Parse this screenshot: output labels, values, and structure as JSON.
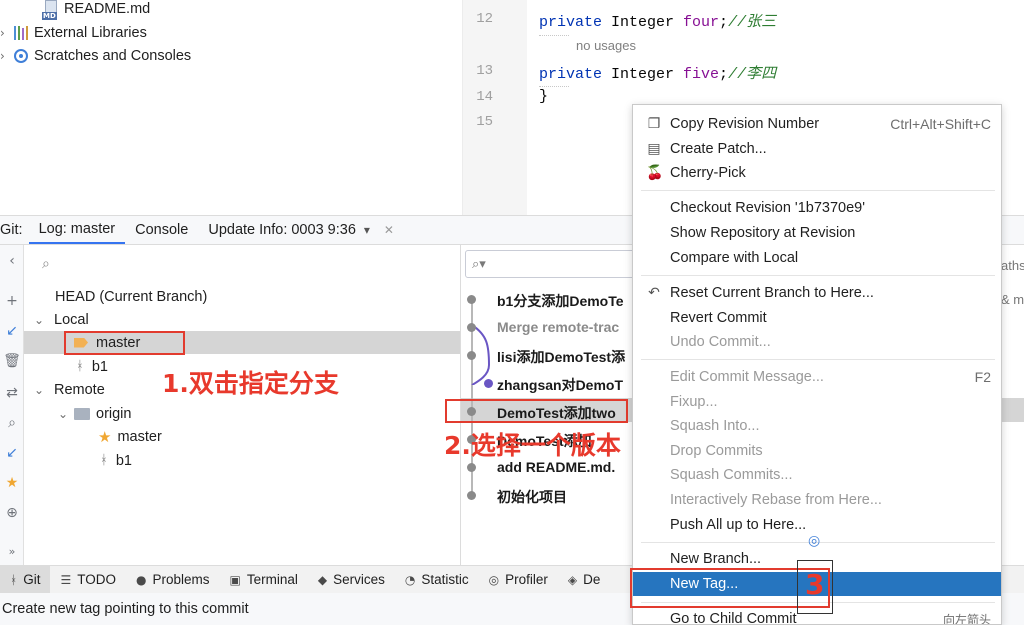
{
  "project_tree": {
    "readme": "README.md",
    "external_libraries": "External Libraries",
    "scratches": "Scratches and Consoles"
  },
  "editor": {
    "lines": [
      {
        "num": "12",
        "kw": "private",
        "type": " Integer ",
        "field": "four",
        "semi": ";",
        "comment": "//张三"
      },
      {
        "num": "13",
        "kw": "private",
        "type": " Integer ",
        "field": "five",
        "semi": ";",
        "comment": "//李四"
      },
      {
        "num": "14",
        "text": "}"
      },
      {
        "num": "15",
        "text": ""
      }
    ],
    "hint": "no usages"
  },
  "git_tabs": {
    "prefix": "Git:",
    "log": "Log: master",
    "console": "Console",
    "update": "Update Info: 0003 9:36",
    "dropdown_icon": "▾",
    "close_icon": "✕"
  },
  "branches": {
    "head": "HEAD (Current Branch)",
    "local": "Local",
    "master": "master",
    "b1": "b1",
    "remote": "Remote",
    "origin": "origin",
    "origin_master": "master",
    "origin_b1": "b1"
  },
  "commits": [
    {
      "msg": "b1分支添加DemoTe",
      "dim": false
    },
    {
      "msg": "Merge remote-trac",
      "dim": true
    },
    {
      "msg": "lisi添加DemoTest添",
      "dim": false
    },
    {
      "msg": "zhangsan对DemoT",
      "dim": false
    },
    {
      "msg": "DemoTest添加two",
      "dim": false
    },
    {
      "msg": "DemoTest添加",
      "dim": false
    },
    {
      "msg": "add README.md.",
      "dim": false
    },
    {
      "msg": "初始化项目",
      "dim": false
    }
  ],
  "commit_panel_right": {
    "a": "aths",
    "b": "& ma"
  },
  "context_menu": {
    "items": [
      {
        "label": "Copy Revision Number",
        "shortcut": "Ctrl+Alt+Shift+C",
        "icon": "❐",
        "state": "normal"
      },
      {
        "label": "Create Patch...",
        "shortcut": "",
        "icon": "▤",
        "state": "normal"
      },
      {
        "label": "Cherry-Pick",
        "shortcut": "",
        "icon": "🍒",
        "state": "normal"
      },
      {
        "label": "Checkout Revision '1b7370e9'",
        "shortcut": "",
        "icon": "",
        "state": "normal"
      },
      {
        "label": "Show Repository at Revision",
        "shortcut": "",
        "icon": "",
        "state": "normal"
      },
      {
        "label": "Compare with Local",
        "shortcut": "",
        "icon": "",
        "state": "normal"
      },
      {
        "label": "Reset Current Branch to Here...",
        "shortcut": "",
        "icon": "↶",
        "state": "normal"
      },
      {
        "label": "Revert Commit",
        "shortcut": "",
        "icon": "",
        "state": "normal"
      },
      {
        "label": "Undo Commit...",
        "shortcut": "",
        "icon": "",
        "state": "disabled"
      },
      {
        "label": "Edit Commit Message...",
        "shortcut": "F2",
        "icon": "",
        "state": "disabled"
      },
      {
        "label": "Fixup...",
        "shortcut": "",
        "icon": "",
        "state": "disabled"
      },
      {
        "label": "Squash Into...",
        "shortcut": "",
        "icon": "",
        "state": "disabled"
      },
      {
        "label": "Drop Commits",
        "shortcut": "",
        "icon": "",
        "state": "disabled"
      },
      {
        "label": "Squash Commits...",
        "shortcut": "",
        "icon": "",
        "state": "disabled"
      },
      {
        "label": "Interactively Rebase from Here...",
        "shortcut": "",
        "icon": "",
        "state": "disabled"
      },
      {
        "label": "Push All up to Here...",
        "shortcut": "",
        "icon": "",
        "state": "normal"
      },
      {
        "label": "New Branch...",
        "shortcut": "",
        "icon": "",
        "state": "normal"
      },
      {
        "label": "New Tag...",
        "shortcut": "",
        "icon": "",
        "state": "highlighted"
      },
      {
        "label": "Go to Child Commit",
        "shortcut": "向左箭头",
        "icon": "",
        "state": "normal"
      }
    ]
  },
  "tool_windows": [
    {
      "label": "Git",
      "icon": "ᚼ",
      "active": true
    },
    {
      "label": "TODO",
      "icon": "☰",
      "active": false
    },
    {
      "label": "Problems",
      "icon": "●",
      "active": false
    },
    {
      "label": "Terminal",
      "icon": "▣",
      "active": false
    },
    {
      "label": "Services",
      "icon": "◆",
      "active": false
    },
    {
      "label": "Statistic",
      "icon": "◔",
      "active": false
    },
    {
      "label": "Profiler",
      "icon": "◎",
      "active": false
    },
    {
      "label": "De",
      "icon": "◈",
      "active": false
    }
  ],
  "status": "Create new tag pointing to this commit",
  "annotations": {
    "step1": "1.双击指定分支",
    "step2": "2.选择一个版本",
    "step3": "3"
  },
  "icons": {
    "search": "⌕",
    "chevron_right": "›",
    "chevron_down": "⌄"
  }
}
